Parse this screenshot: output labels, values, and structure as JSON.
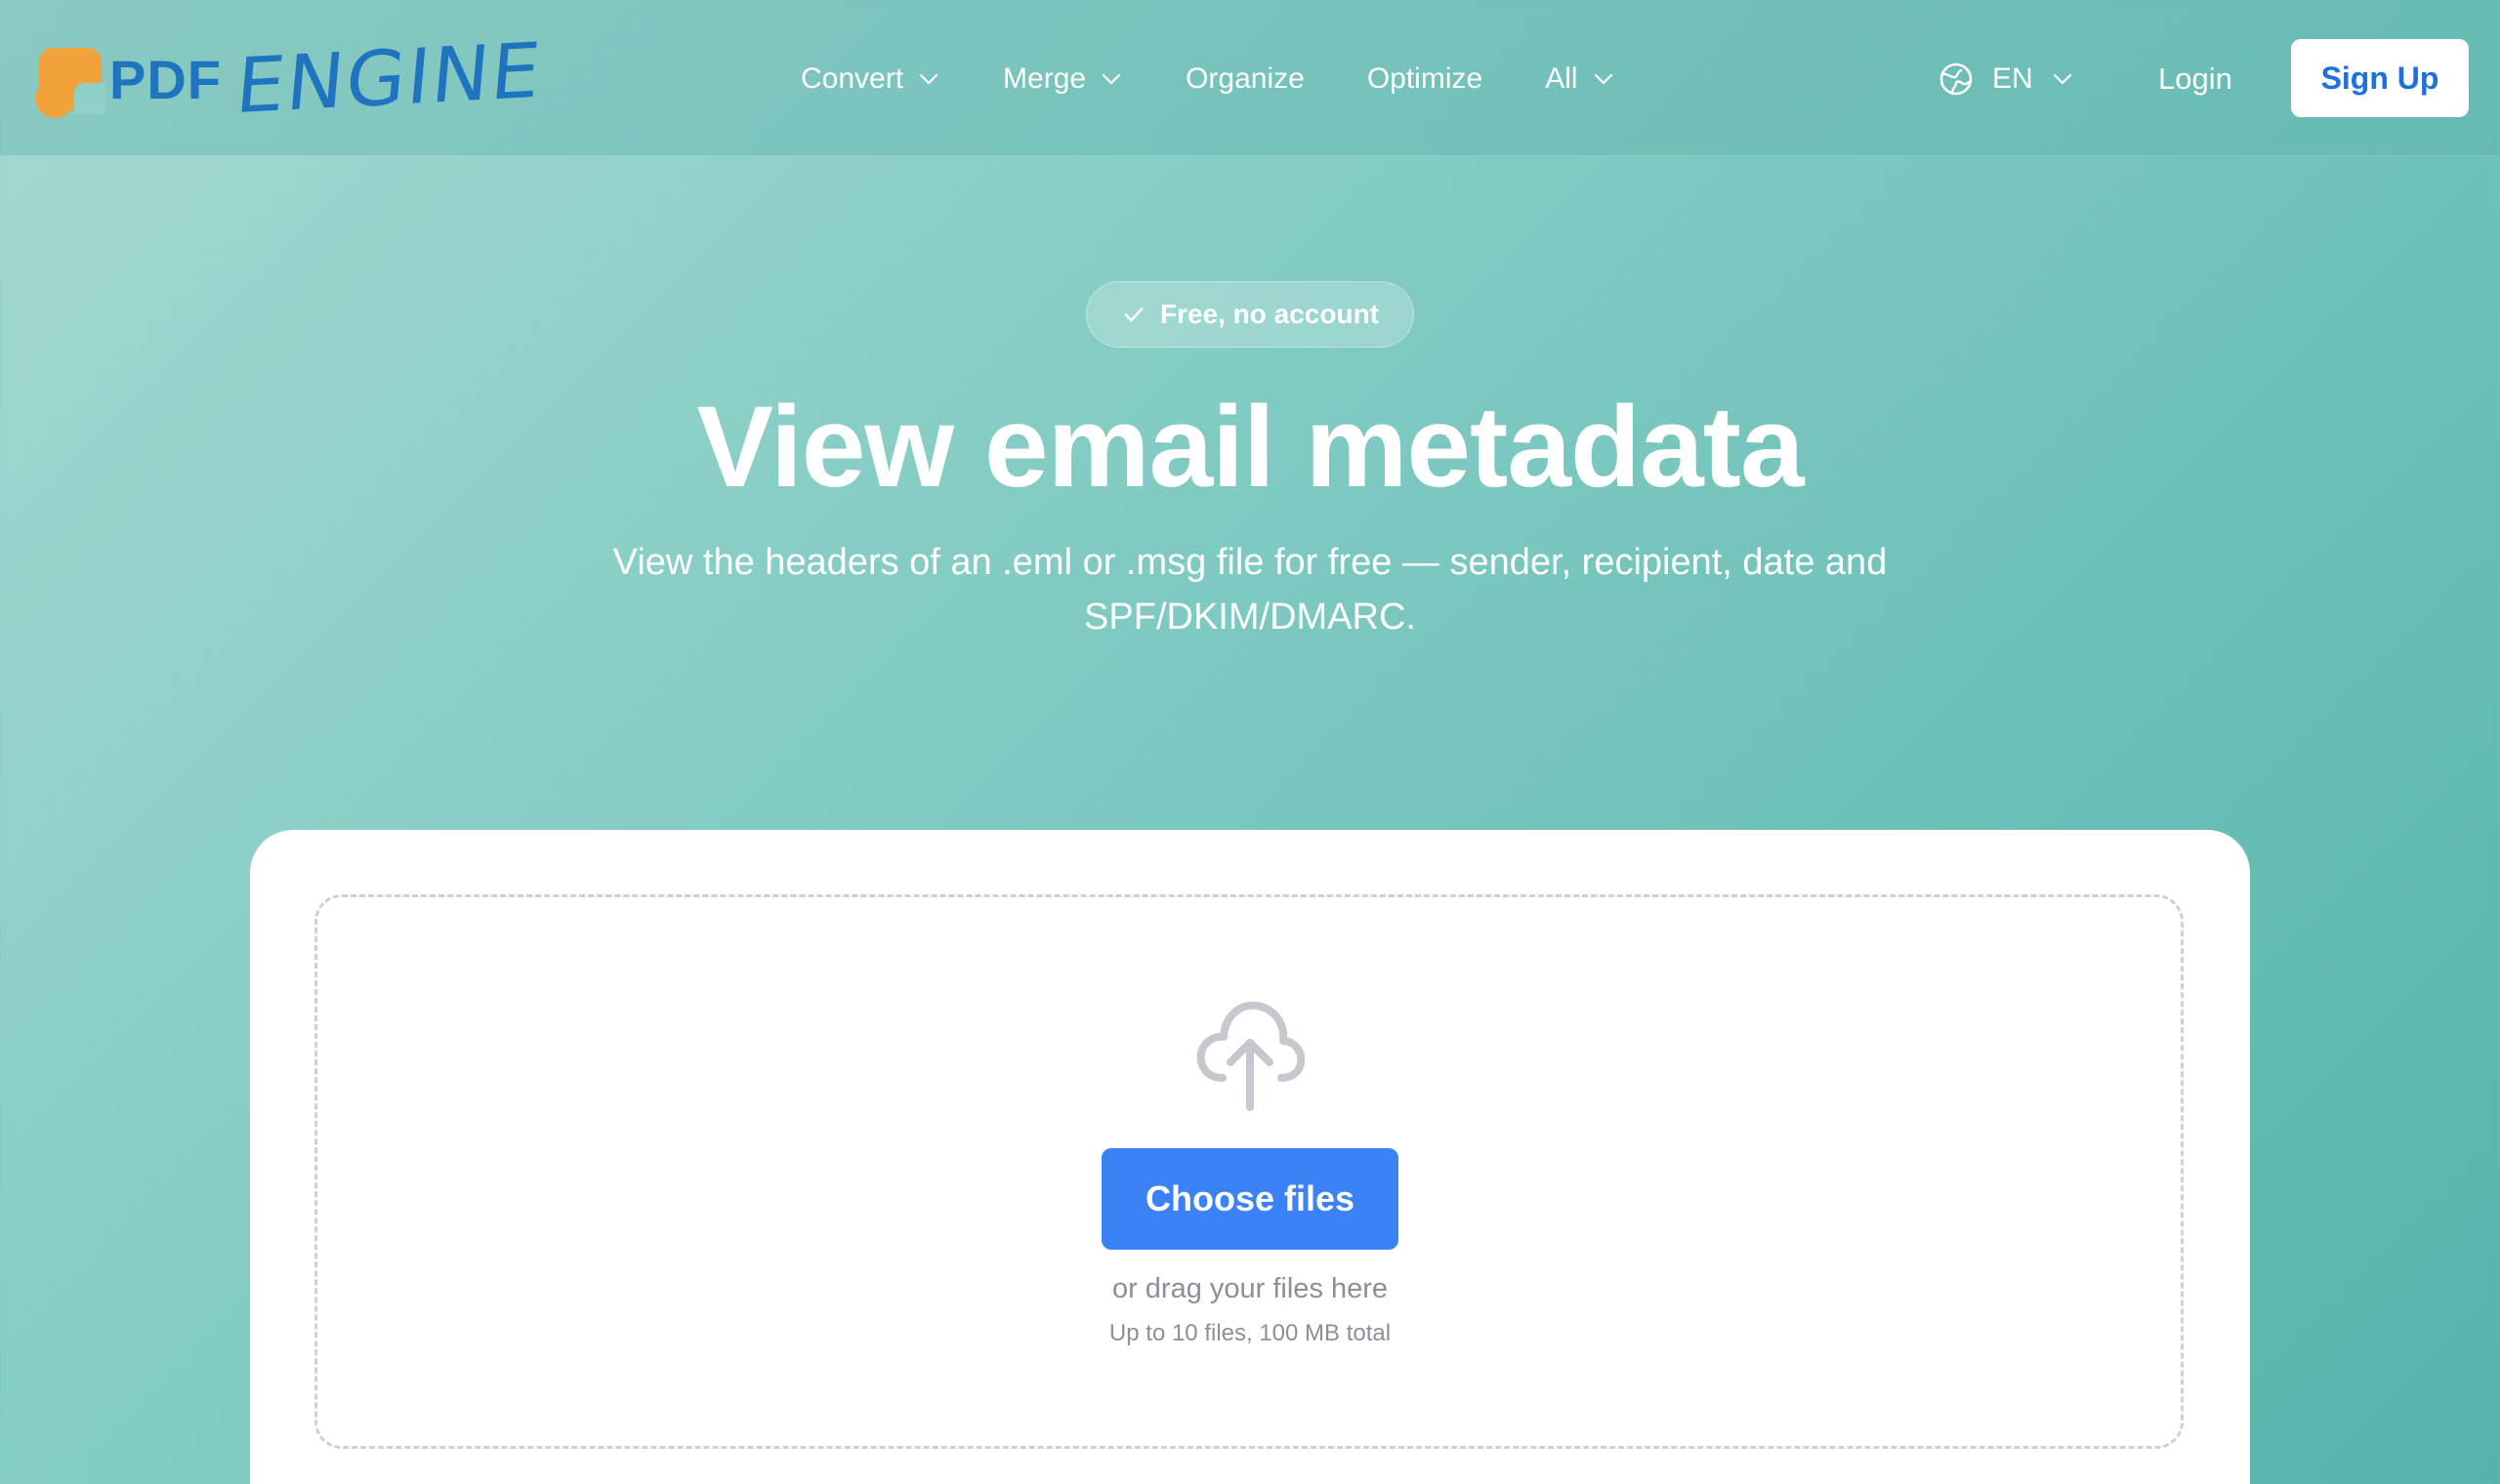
{
  "brand": {
    "name_part1": "PDF",
    "name_part2": "ENGINE"
  },
  "nav": {
    "items": [
      {
        "label": "Convert",
        "has_dropdown": true
      },
      {
        "label": "Merge",
        "has_dropdown": true
      },
      {
        "label": "Organize",
        "has_dropdown": false
      },
      {
        "label": "Optimize",
        "has_dropdown": false
      },
      {
        "label": "All",
        "has_dropdown": true
      }
    ],
    "language": "EN",
    "login_label": "Login",
    "signup_label": "Sign Up"
  },
  "hero": {
    "badge": "Free, no account",
    "title": "View email metadata",
    "subtitle": "View the headers of an .eml or .msg file for free — sender, recipient, date and SPF/DKIM/DMARC."
  },
  "upload": {
    "button_label": "Choose files",
    "drag_text": "or drag your files here",
    "limit_text": "Up to 10 files, 100 MB total"
  },
  "icons": {
    "logo": "logo-mark-icon",
    "dropdown": "chevron-down-icon",
    "language": "globe-icon",
    "badge": "check-icon",
    "upload": "cloud-upload-icon"
  },
  "colors": {
    "background": "#86cdc5",
    "brand_blue": "#1f74c0",
    "brand_orange": "#f2a23a",
    "accent_button": "#3b82f6",
    "signup_text": "#1e6fe0"
  }
}
